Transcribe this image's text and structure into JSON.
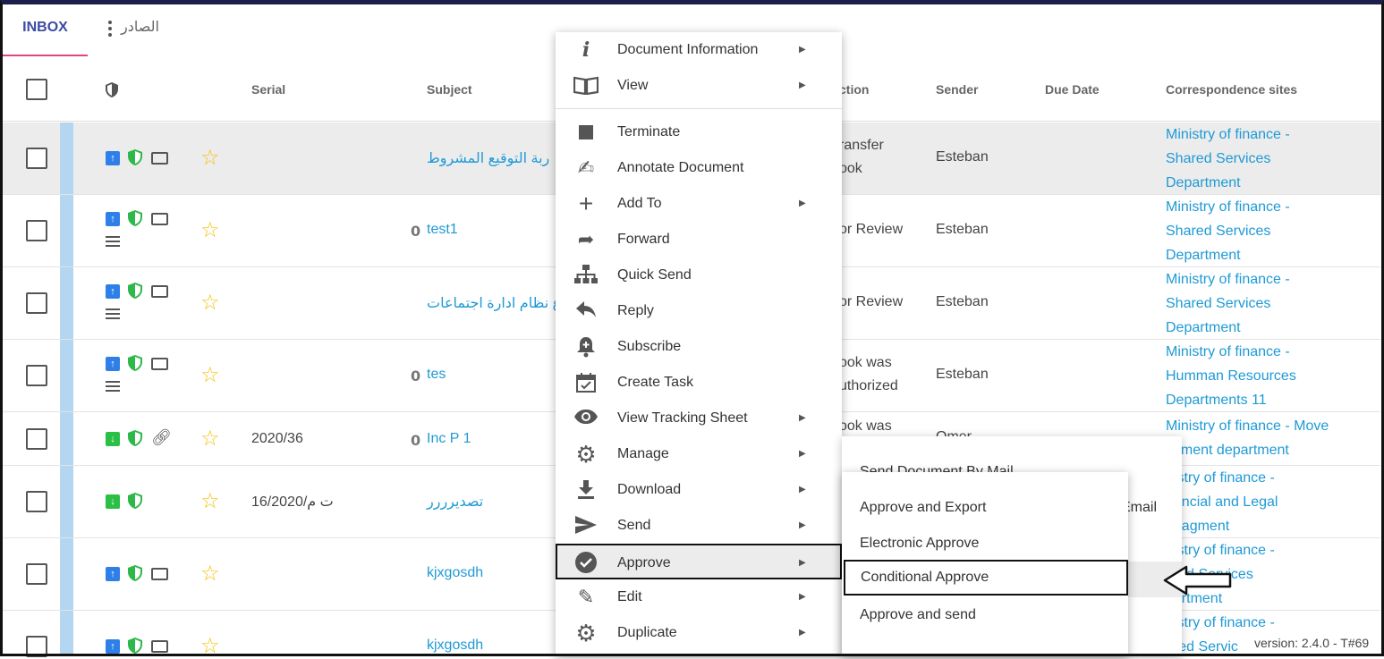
{
  "tabs": {
    "inbox": "INBOX",
    "outbox": "الصادر"
  },
  "columns": {
    "serial": "Serial",
    "subject": "Subject",
    "action": "ction",
    "sender": "Sender",
    "due_date": "Due Date",
    "correspondence_sites": "Correspondence sites"
  },
  "rows": [
    {
      "serial": "",
      "subject": "ربة التوقيع المشروط",
      "action_l1": "ransfer",
      "action_l2": "ook",
      "sender": "Esteban",
      "corr_l1": "Ministry of finance -",
      "corr_l2": "Shared Services",
      "corr_l3": "Department"
    },
    {
      "serial": "",
      "subject": "test1",
      "action_l1": "or Review",
      "action_l2": "",
      "sender": "Esteban",
      "corr_l1": "Ministry of finance -",
      "corr_l2": "Shared Services",
      "corr_l3": "Department"
    },
    {
      "serial": "",
      "subject": "ع نظام ادارة اجتماعات",
      "action_l1": "or Review",
      "action_l2": "",
      "sender": "Esteban",
      "corr_l1": "Ministry of finance -",
      "corr_l2": "Shared Services",
      "corr_l3": "Department"
    },
    {
      "serial": "",
      "subject": "tes",
      "action_l1": "ook was",
      "action_l2": "uthorized",
      "sender": "Esteban",
      "corr_l1": "Ministry of finance -",
      "corr_l2": "Humman Resources",
      "corr_l3": "Departments 11"
    },
    {
      "serial": "2020/36",
      "subject": "Inc P 1",
      "action_l1": "ook was",
      "action_l2": "",
      "sender": "Omer",
      "corr_l1": "Ministry of finance - Move",
      "corr_l2": "cument department",
      "corr_l3": ""
    },
    {
      "serial": "ت م/16/2020",
      "subject": "تصديرررر",
      "action_l1": "",
      "action_l2": "",
      "sender": "",
      "corr_l1": "nistry of finance -",
      "corr_l2": "nancial and Legal",
      "corr_l3": "anagment"
    },
    {
      "serial": "",
      "subject": "kjxgosdh",
      "action_l1": "",
      "action_l2": "",
      "sender": "",
      "corr_l1": "nistry of finance -",
      "corr_l2": "ared Services",
      "corr_l3": "partment"
    },
    {
      "serial": "",
      "subject": "kjxgosdh",
      "action_l1": "",
      "action_l2": "",
      "sender": "",
      "corr_l1": "nistry of finance -",
      "corr_l2": "ared Servic",
      "corr_l3": ""
    }
  ],
  "context_menu": [
    {
      "label": "Document Information",
      "icon": "info-icon",
      "submenu": true
    },
    {
      "label": "View",
      "icon": "book-icon",
      "submenu": true
    },
    {
      "label": "Terminate",
      "icon": "stop-icon",
      "submenu": false
    },
    {
      "label": "Annotate Document",
      "icon": "signature-icon",
      "submenu": false
    },
    {
      "label": "Add To",
      "icon": "plus-icon",
      "submenu": true
    },
    {
      "label": "Forward",
      "icon": "forward-icon",
      "submenu": false
    },
    {
      "label": "Quick Send",
      "icon": "sitemap-icon",
      "submenu": false
    },
    {
      "label": "Reply",
      "icon": "reply-icon",
      "submenu": false
    },
    {
      "label": "Subscribe",
      "icon": "bell-plus-icon",
      "submenu": false
    },
    {
      "label": "Create Task",
      "icon": "calendar-check-icon",
      "submenu": false
    },
    {
      "label": "View Tracking Sheet",
      "icon": "eye-icon",
      "submenu": true
    },
    {
      "label": "Manage",
      "icon": "gear-icon",
      "submenu": true
    },
    {
      "label": "Download",
      "icon": "download-icon",
      "submenu": true
    },
    {
      "label": "Send",
      "icon": "send-icon",
      "submenu": true
    },
    {
      "label": "Approve",
      "icon": "approve-badge-icon",
      "submenu": true
    },
    {
      "label": "Edit",
      "icon": "pencil-icon",
      "submenu": true
    },
    {
      "label": "Duplicate",
      "icon": "gear-icon",
      "submenu": true
    }
  ],
  "send_submenu": {
    "item1": "Send Document By Mail",
    "email": "Email"
  },
  "approve_submenu": [
    "Approve and Export",
    "Electronic Approve",
    "Conditional Approve",
    "Approve and send"
  ],
  "version": "version: 2.4.0 - T#69"
}
